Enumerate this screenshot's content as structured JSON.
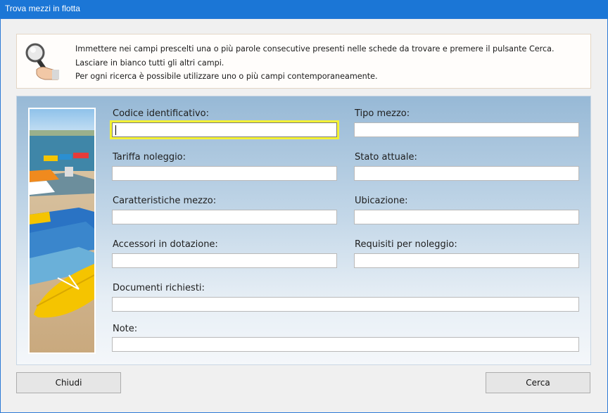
{
  "window": {
    "title": "Trova mezzi in flotta"
  },
  "info": {
    "line1": "Immettere nei campi prescelti una o più parole consecutive presenti nelle schede da trovare e premere il pulsante Cerca.",
    "line2": "Lasciare in bianco tutti gli altri campi.",
    "line3": "Per ogni ricerca è possibile utilizzare uno o più campi contemporaneamente."
  },
  "fields": {
    "codice": {
      "label": "Codice identificativo:",
      "value": ""
    },
    "tipo": {
      "label": "Tipo mezzo:",
      "value": ""
    },
    "tariffa": {
      "label": "Tariffa noleggio:",
      "value": ""
    },
    "stato": {
      "label": "Stato attuale:",
      "value": ""
    },
    "caratteristiche": {
      "label": "Caratteristiche mezzo:",
      "value": ""
    },
    "ubicazione": {
      "label": "Ubicazione:",
      "value": ""
    },
    "accessori": {
      "label": "Accessori in dotazione:",
      "value": ""
    },
    "requisiti": {
      "label": "Requisiti per noleggio:",
      "value": ""
    },
    "documenti": {
      "label": "Documenti richiesti:",
      "value": ""
    },
    "note": {
      "label": "Note:",
      "value": ""
    }
  },
  "buttons": {
    "close": "Chiudi",
    "search": "Cerca"
  },
  "colors": {
    "titlebar": "#1b76d6",
    "focus_border": "#f3f134",
    "kayak_yellow": "#f5c400"
  },
  "icons": {
    "info_icon": "magnifier-hand-icon"
  }
}
